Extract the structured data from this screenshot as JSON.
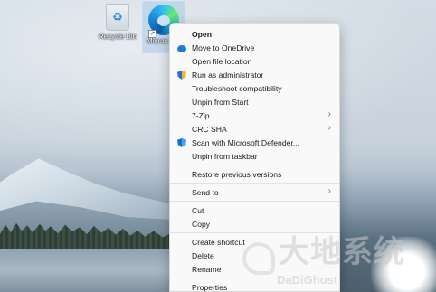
{
  "desktop": {
    "icons": [
      {
        "label": "Recycle Bin",
        "icon": "recycle-bin-icon"
      },
      {
        "label": "Microsoft Edge",
        "label_visible": "Micros Edg",
        "icon": "edge-icon"
      }
    ]
  },
  "context_menu": {
    "items": [
      {
        "label": "Open",
        "bold": true
      },
      {
        "label": "Move to OneDrive",
        "icon": "onedrive-cloud-icon"
      },
      {
        "label": "Open file location"
      },
      {
        "label": "Run as administrator",
        "icon": "uac-shield-icon"
      },
      {
        "label": "Troubleshoot compatibility"
      },
      {
        "label": "Unpin from Start"
      },
      {
        "label": "7-Zip",
        "submenu": true
      },
      {
        "label": "CRC SHA",
        "submenu": true
      },
      {
        "label": "Scan with Microsoft Defender...",
        "icon": "defender-shield-icon"
      },
      {
        "label": "Unpin from taskbar"
      },
      {
        "label": "Restore previous versions"
      },
      {
        "label": "Send to",
        "submenu": true
      },
      {
        "label": "Cut"
      },
      {
        "label": "Copy"
      },
      {
        "label": "Create shortcut"
      },
      {
        "label": "Delete"
      },
      {
        "label": "Rename"
      },
      {
        "label": "Properties"
      }
    ],
    "submenu_glyph": "›"
  },
  "watermark": {
    "text": "大地系统",
    "sub": "DaDiGhost"
  },
  "colors": {
    "menu_bg": "#f9f9f9",
    "accent": "#1f7bd6"
  }
}
